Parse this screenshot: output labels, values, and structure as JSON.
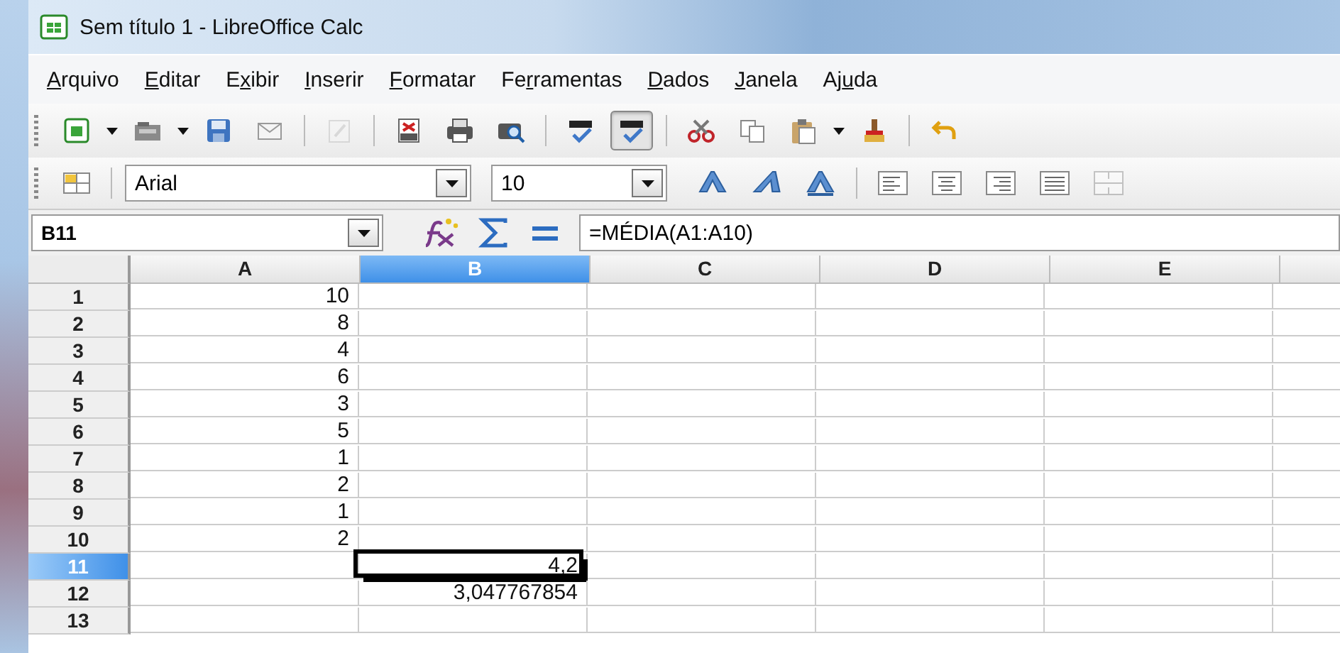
{
  "window": {
    "title": "Sem título 1 - LibreOffice Calc"
  },
  "menu": [
    {
      "key": "A",
      "after": "rquivo"
    },
    {
      "key": "E",
      "after": "ditar"
    },
    {
      "before": "E",
      "key": "x",
      "after": "ibir"
    },
    {
      "key": "I",
      "after": "nserir"
    },
    {
      "key": "F",
      "after": "ormatar"
    },
    {
      "before": "Fe",
      "key": "r",
      "after": "ramentas"
    },
    {
      "key": "D",
      "after": "ados"
    },
    {
      "key": "J",
      "after": "anela"
    },
    {
      "before": "Aj",
      "key": "u",
      "after": "da"
    }
  ],
  "toolbar_1": [
    {
      "kind": "new",
      "dropdown": true,
      "disabled": false,
      "selected": false
    },
    {
      "kind": "open",
      "dropdown": true,
      "disabled": false,
      "selected": false
    },
    {
      "kind": "save",
      "disabled": false,
      "selected": false
    },
    {
      "kind": "email",
      "disabled": false,
      "selected": false
    },
    {
      "kind": "separator"
    },
    {
      "kind": "edit",
      "disabled": true,
      "selected": false
    },
    {
      "kind": "separator"
    },
    {
      "kind": "pdf",
      "disabled": false,
      "selected": false
    },
    {
      "kind": "print",
      "disabled": false,
      "selected": false
    },
    {
      "kind": "preview",
      "disabled": false,
      "selected": false
    },
    {
      "kind": "separator"
    },
    {
      "kind": "spell",
      "disabled": false,
      "selected": false
    },
    {
      "kind": "autospell",
      "disabled": false,
      "selected": true
    },
    {
      "kind": "separator"
    },
    {
      "kind": "cut",
      "disabled": false,
      "selected": false
    },
    {
      "kind": "copy",
      "disabled": false,
      "selected": false
    },
    {
      "kind": "paste",
      "dropdown": true,
      "disabled": false,
      "selected": false
    },
    {
      "kind": "brush",
      "disabled": false,
      "selected": false
    },
    {
      "kind": "separator"
    },
    {
      "kind": "undo",
      "disabled": false,
      "selected": false
    }
  ],
  "toolbar_2": {
    "font_name": "Arial",
    "font_size": "10",
    "buttons": [
      {
        "kind": "bold",
        "disabled": false
      },
      {
        "kind": "italic",
        "disabled": false
      },
      {
        "kind": "underline",
        "disabled": false
      },
      {
        "kind": "separator"
      },
      {
        "kind": "align-left",
        "disabled": false
      },
      {
        "kind": "align-center",
        "disabled": false
      },
      {
        "kind": "align-right",
        "disabled": false
      },
      {
        "kind": "justify",
        "disabled": false
      },
      {
        "kind": "merge",
        "disabled": true
      }
    ]
  },
  "formula_bar": {
    "name_box": "B11",
    "formula": "=MÉDIA(A1:A10)"
  },
  "columns": [
    {
      "label": "A",
      "selected": false
    },
    {
      "label": "B",
      "selected": true
    },
    {
      "label": "C",
      "selected": false
    },
    {
      "label": "D",
      "selected": false
    },
    {
      "label": "E",
      "selected": false
    }
  ],
  "rows": [
    {
      "header": "1",
      "selected": false,
      "col_a": "10"
    },
    {
      "header": "2",
      "selected": false,
      "col_a": "8"
    },
    {
      "header": "3",
      "selected": false,
      "col_a": "4"
    },
    {
      "header": "4",
      "selected": false,
      "col_a": "6"
    },
    {
      "header": "5",
      "selected": false,
      "col_a": "3"
    },
    {
      "header": "6",
      "selected": false,
      "col_a": "5"
    },
    {
      "header": "7",
      "selected": false,
      "col_a": "1"
    },
    {
      "header": "8",
      "selected": false,
      "col_a": "2"
    },
    {
      "header": "9",
      "selected": false,
      "col_a": "1"
    },
    {
      "header": "10",
      "selected": false,
      "col_a": "2"
    },
    {
      "header": "11",
      "selected": true,
      "col_b": "4,2",
      "b_active": true
    },
    {
      "header": "12",
      "selected": false,
      "col_b": "3,047767854"
    },
    {
      "header": "13",
      "selected": false
    }
  ]
}
